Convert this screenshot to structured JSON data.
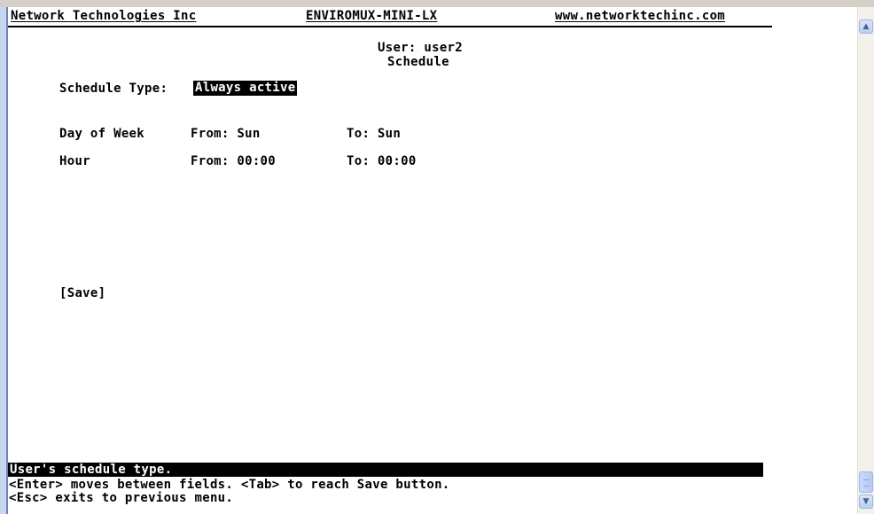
{
  "header": {
    "company": "Network Technologies Inc",
    "product": "ENVIROMUX-MINI-LX",
    "website": "www.networktechinc.com"
  },
  "page": {
    "user_line": "User: user2",
    "title": "Schedule"
  },
  "schedule": {
    "type_label": "Schedule Type:",
    "type_value": "Always active",
    "day_label": "Day of Week",
    "day_from": "From: Sun",
    "day_to": "To: Sun",
    "hour_label": "Hour",
    "hour_from": "From: 00:00",
    "hour_to": "To: 00:00"
  },
  "actions": {
    "save_label": "[Save]"
  },
  "help": {
    "field_description": "User's schedule type.",
    "line1": "<Enter> moves between fields. <Tab> to reach Save button.",
    "line2": "<Esc> exits to previous menu."
  },
  "scrollbar": {
    "up_icon": "arrow-up-icon",
    "down_icon": "arrow-down-icon"
  }
}
